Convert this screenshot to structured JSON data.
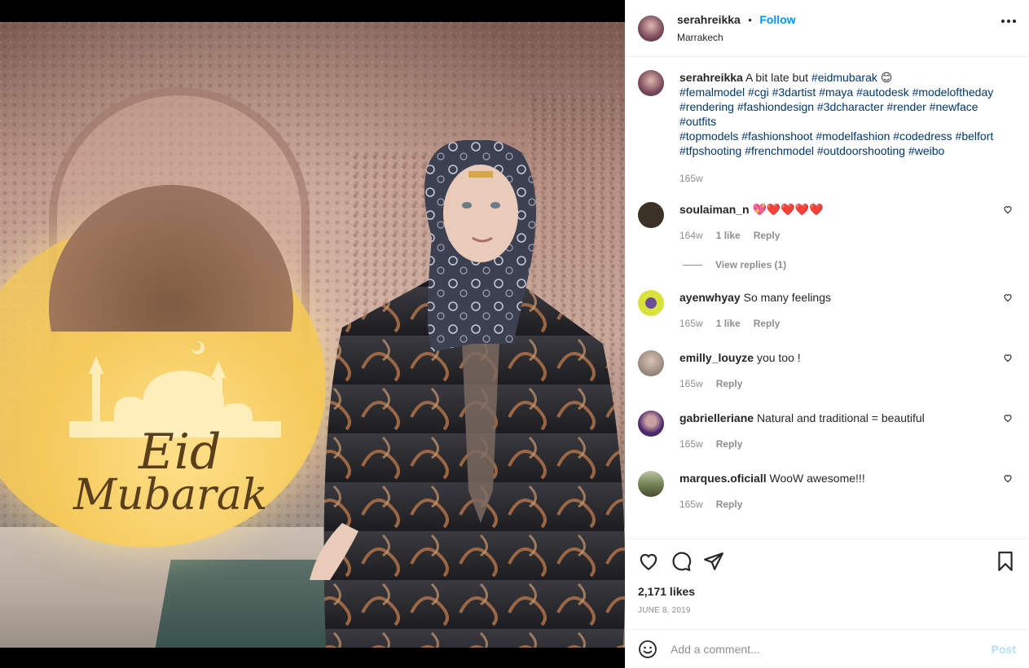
{
  "post": {
    "username": "serahreikka",
    "follow_label": "Follow",
    "separator": "•",
    "location": "Marrakech",
    "image_text": {
      "line1": "Eid",
      "line2": "Mubarak"
    }
  },
  "caption": {
    "username": "serahreikka",
    "text": "A bit late but",
    "first_tag": "#eidmubarak",
    "emoji": "😊",
    "tags_line1": "#femalmodel #cgi #3dartist #maya #autodesk #modeloftheday",
    "tags_line2": "#rendering #fashiondesign #3dcharacter #render #newface",
    "tags_line3": "#outfits",
    "tags_line4": "#topmodels #fashionshoot #modelfashion #codedress #belfort",
    "tags_line5": "#tfpshooting #frenchmodel #outdoorshooting #weibo",
    "time": "165w"
  },
  "comments": [
    {
      "username": "soulaiman_n",
      "text": "💖❤️❤️❤️❤️",
      "time": "164w",
      "likes": "1 like",
      "reply": "Reply",
      "avatar_color": "#3a3226"
    },
    {
      "username": "ayenwhyay",
      "text": "So many feelings",
      "time": "165w",
      "likes": "1 like",
      "reply": "Reply",
      "avatar_color": "#d8e23a"
    },
    {
      "username": "emilly_louyze",
      "text": "you too !",
      "time": "165w",
      "likes": "",
      "reply": "Reply",
      "avatar_color": "#b8a8a0"
    },
    {
      "username": "gabrielleriane",
      "text": "Natural and traditional = beautiful",
      "time": "165w",
      "likes": "",
      "reply": "Reply",
      "avatar_color": "#4a2a6a"
    },
    {
      "username": "marques.oficiall",
      "text": "WooW awesome!!!",
      "time": "165w",
      "likes": "",
      "reply": "Reply",
      "avatar_color": "#6a7a4a"
    }
  ],
  "view_replies": "View replies (1)",
  "likes": "2,171 likes",
  "date": "JUNE 8, 2019",
  "add_comment": {
    "placeholder": "Add a comment...",
    "post_label": "Post"
  },
  "colors": {
    "link": "#0095f6",
    "hashtag": "#00376b",
    "muted": "#8e8e8e"
  },
  "icons": [
    "more-icon",
    "heart-icon",
    "comment-icon",
    "share-icon",
    "bookmark-icon",
    "emoji-icon"
  ]
}
